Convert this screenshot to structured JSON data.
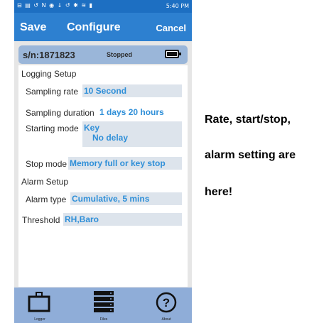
{
  "status_bar": {
    "left_icons": "⊟ ▤ ↺ N ◉ ↓   ↺ ✱ ≋ ▮",
    "time": "5:40 PM"
  },
  "header": {
    "save": "Save",
    "title": "Configure",
    "cancel": "Cancel",
    "color": "#2d80d0"
  },
  "device": {
    "serial": "s/n:1871823",
    "status": "Stopped"
  },
  "logging": {
    "heading": "Logging Setup",
    "sampling_rate_label": "Sampling rate",
    "sampling_rate_value": "10 Second",
    "sampling_duration_label": "Sampling duration",
    "sampling_duration_value": "1 days 20 hours",
    "starting_mode_label": "Starting mode",
    "starting_mode_value_1": "Key",
    "starting_mode_value_2": "No delay",
    "stop_mode_label": "Stop mode",
    "stop_mode_value": "Memory full or key stop"
  },
  "alarm": {
    "heading": "Alarm Setup",
    "alarm_type_label": "Alarm type",
    "alarm_type_value": "Cumulative, 5 mins",
    "threshold_label": "Threshold",
    "threshold_value": "RH,Baro"
  },
  "nav": {
    "logger": "Logger",
    "files": "Files",
    "about": "About"
  },
  "annotation": {
    "line1": "Rate, start/stop,",
    "line2": "alarm setting are",
    "line3": "here!"
  }
}
